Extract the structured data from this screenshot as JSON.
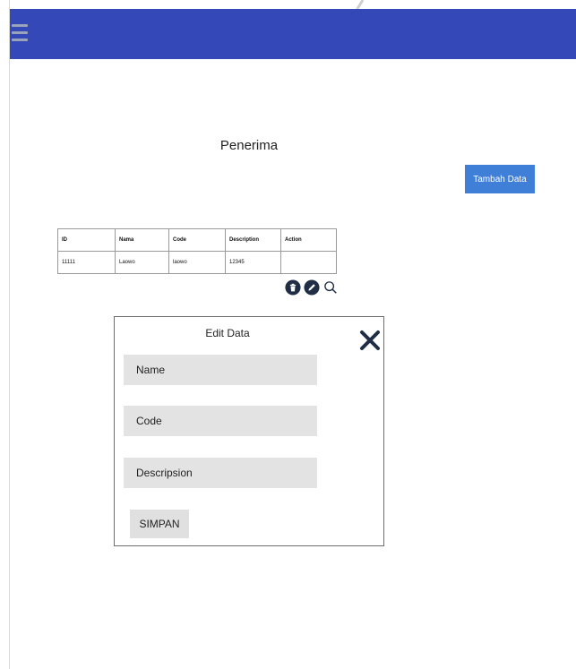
{
  "header": {
    "background": "#3449b7",
    "menu_icon": "hamburger-icon"
  },
  "page": {
    "title": "Penerima",
    "add_button_label": "Tambah Data",
    "accent": "#3f7fd8"
  },
  "table": {
    "columns": [
      "ID",
      "Nama",
      "Code",
      "Description",
      "Action"
    ],
    "rows": [
      {
        "id": "11111",
        "nama": "Laowo",
        "code": "laowo",
        "description": "12345",
        "action": ""
      }
    ]
  },
  "actions": {
    "icons": [
      "trash-icon",
      "edit-icon",
      "search-icon"
    ]
  },
  "modal": {
    "title": "Edit Data",
    "close_icon": "close-icon",
    "fields": [
      {
        "placeholder": "Name",
        "value": ""
      },
      {
        "placeholder": "Code",
        "value": ""
      },
      {
        "placeholder": "Descripsion",
        "value": ""
      }
    ],
    "save_label": "SIMPAN"
  }
}
